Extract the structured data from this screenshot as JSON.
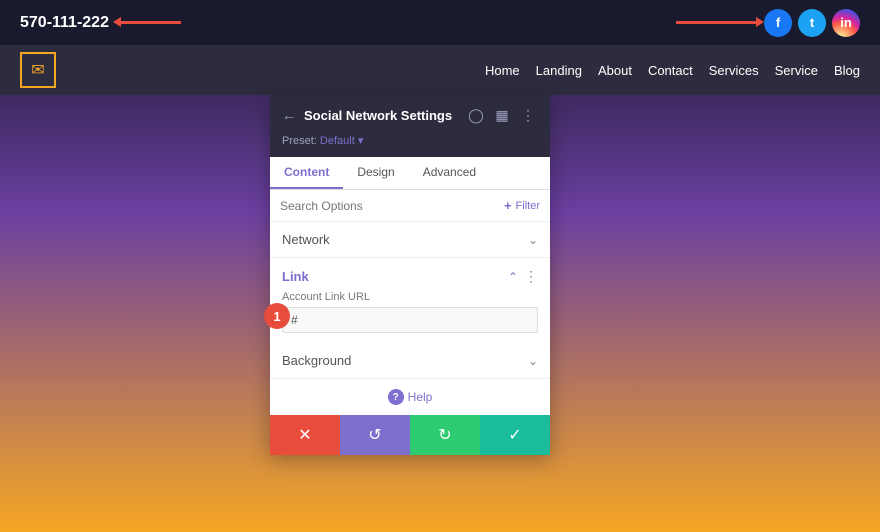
{
  "topbar": {
    "phone": "570-111-222",
    "arrow_left": "←",
    "arrow_right": "→",
    "social": {
      "facebook": "f",
      "twitter": "t",
      "instagram": "ig"
    }
  },
  "secondbar": {
    "envelope": "✉",
    "nav": [
      "Home",
      "Landing",
      "About",
      "Contact",
      "Services",
      "Service",
      "Blog"
    ]
  },
  "panel": {
    "back_label": "←",
    "title": "Social Network Settings",
    "preset_label": "Preset: Default ▾",
    "tabs": [
      "Content",
      "Design",
      "Advanced"
    ],
    "active_tab": "Content",
    "search_placeholder": "Search Options",
    "filter_label": "Filter",
    "sections": {
      "network": {
        "label": "Network",
        "expanded": false
      },
      "link": {
        "label": "Link",
        "expanded": true,
        "fields": [
          {
            "label": "Account Link URL",
            "value": "#",
            "placeholder": "#"
          }
        ]
      },
      "background": {
        "label": "Background",
        "expanded": false
      }
    },
    "help_label": "Help",
    "badge": "1",
    "actions": {
      "cancel": "✕",
      "reset": "↺",
      "redo": "↻",
      "save": "✓"
    },
    "header_icons": {
      "responsive": "📱",
      "layout": "▣",
      "more": "⋮"
    }
  }
}
